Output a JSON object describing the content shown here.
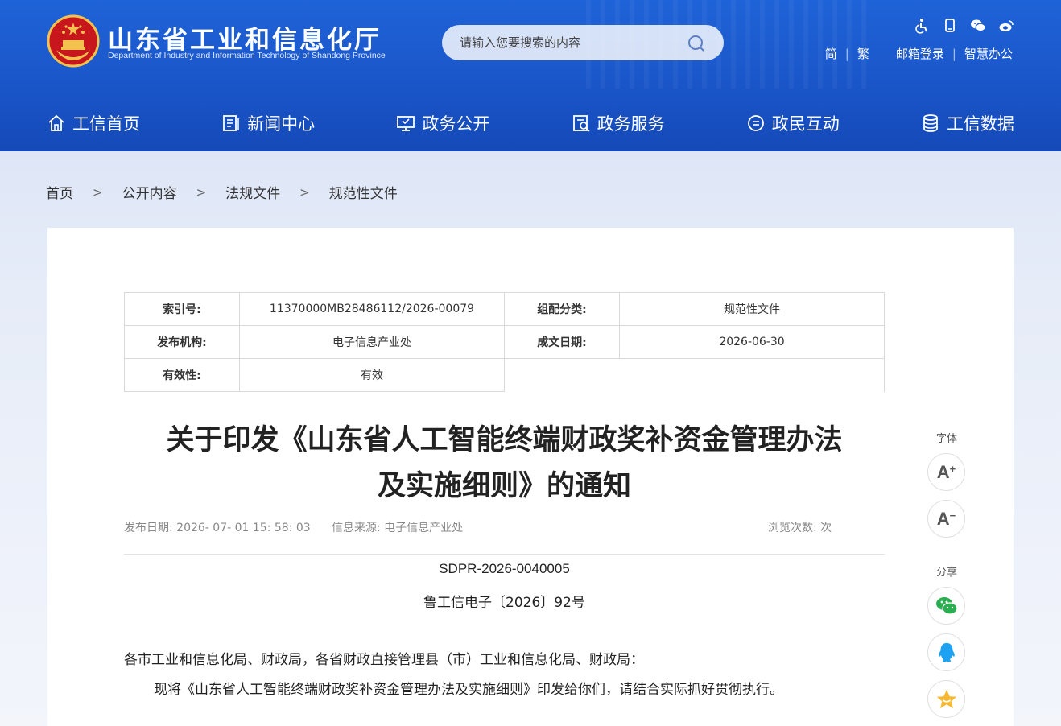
{
  "header": {
    "title": "山东省工业和信息化厅",
    "subtitle": "Department of Industry and Information Technology of Shandong Province",
    "search_placeholder": "请输入您要搜索的内容",
    "tool_icons": [
      "accessibility-icon",
      "mobile-icon",
      "wechat-icon",
      "weibo-icon"
    ],
    "links": {
      "simplified": "简",
      "traditional": "繁",
      "mail_login": "邮箱登录",
      "smart_office": "智慧办公"
    },
    "nav": [
      {
        "label": "工信首页",
        "icon": "home-icon"
      },
      {
        "label": "新闻中心",
        "icon": "news-icon"
      },
      {
        "label": "政务公开",
        "icon": "monitor-icon"
      },
      {
        "label": "政务服务",
        "icon": "service-icon"
      },
      {
        "label": "政民互动",
        "icon": "chat-icon"
      },
      {
        "label": "工信数据",
        "icon": "database-icon"
      }
    ],
    "colors": {
      "header_blue": "#1a56c9",
      "emblem_red": "#c8161d",
      "emblem_gold": "#f2c14e"
    }
  },
  "breadcrumb": [
    "首页",
    "公开内容",
    "法规文件",
    "规范性文件"
  ],
  "breadcrumb_separator": ">",
  "meta": {
    "index_label": "索引号:",
    "index_value": "11370000MB28486112/2026-00079",
    "category_label": "组配分类:",
    "category_value": "规范性文件",
    "publisher_label": "发布机构:",
    "publisher_value": "电子信息产业处",
    "date_label": "成文日期:",
    "date_value": "2026-06-30",
    "validity_label": "有效性:",
    "validity_value": "有效"
  },
  "article": {
    "title_line1": "关于印发《山东省人工智能终端财政奖补资金管理办法",
    "title_line2": "及实施细则》的通知",
    "publish_date": "发布日期: 2026- 07- 01 15: 58: 03",
    "source": "信息来源: 电子信息产业处",
    "views": "浏览次数:   次",
    "code1": "SDPR-2026-0040005",
    "code2": "鲁工信电子〔2026〕92号",
    "para1": "各市工业和信息化局、财政局，各省财政直接管理县（市）工业和信息化局、财政局：",
    "para2": "现将《山东省人工智能终端财政奖补资金管理办法及实施细则》印发给你们，请结合实际抓好贯彻执行。"
  },
  "side": {
    "font_label": "字体",
    "font_increase": "A",
    "font_decrease": "A",
    "font_increase_mark": "+",
    "font_decrease_mark": "−",
    "share_label": "分享",
    "share_icons": [
      "wechat-share-icon",
      "qq-share-icon",
      "favorite-star-icon"
    ]
  }
}
